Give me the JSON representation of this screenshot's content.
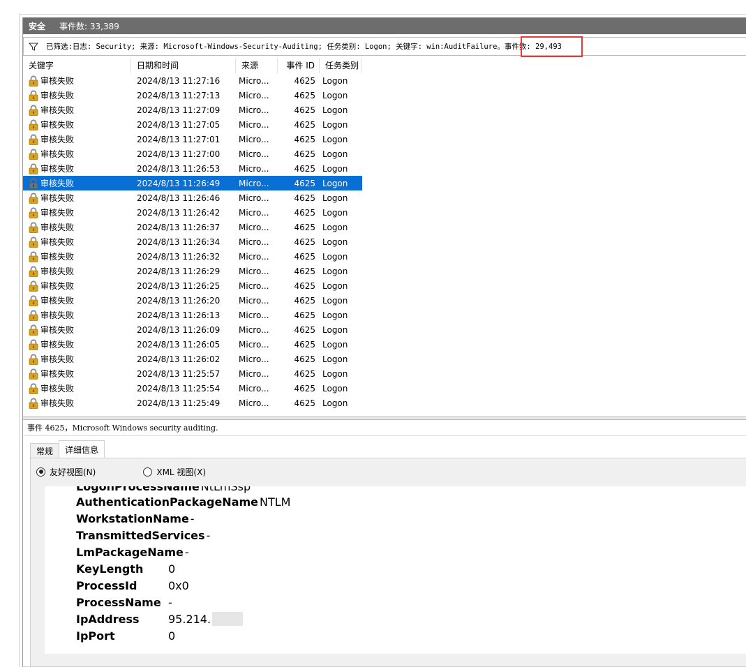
{
  "title_bar": {
    "log_name": "安全",
    "event_count": "事件数: 33,389"
  },
  "filter": {
    "text": "已筛选:日志: Security; 来源: Microsoft-Windows-Security-Auditing; 任务类别: Logon; 关键字: win:AuditFailure。事件数: 29,493",
    "icon": "funnel-icon"
  },
  "columns": [
    "关键字",
    "日期和时间",
    "来源",
    "事件 ID",
    "任务类别"
  ],
  "rows": [
    {
      "keyword": "审核失败",
      "datetime": "2024/8/13 11:27:16",
      "source": "Micro...",
      "event_id": "4625",
      "category": "Logon"
    },
    {
      "keyword": "审核失败",
      "datetime": "2024/8/13 11:27:13",
      "source": "Micro...",
      "event_id": "4625",
      "category": "Logon"
    },
    {
      "keyword": "审核失败",
      "datetime": "2024/8/13 11:27:09",
      "source": "Micro...",
      "event_id": "4625",
      "category": "Logon"
    },
    {
      "keyword": "审核失败",
      "datetime": "2024/8/13 11:27:05",
      "source": "Micro...",
      "event_id": "4625",
      "category": "Logon"
    },
    {
      "keyword": "审核失败",
      "datetime": "2024/8/13 11:27:01",
      "source": "Micro...",
      "event_id": "4625",
      "category": "Logon"
    },
    {
      "keyword": "审核失败",
      "datetime": "2024/8/13 11:27:00",
      "source": "Micro...",
      "event_id": "4625",
      "category": "Logon"
    },
    {
      "keyword": "审核失败",
      "datetime": "2024/8/13 11:26:53",
      "source": "Micro...",
      "event_id": "4625",
      "category": "Logon"
    },
    {
      "keyword": "审核失败",
      "datetime": "2024/8/13 11:26:49",
      "source": "Micro...",
      "event_id": "4625",
      "category": "Logon",
      "selected": true
    },
    {
      "keyword": "审核失败",
      "datetime": "2024/8/13 11:26:46",
      "source": "Micro...",
      "event_id": "4625",
      "category": "Logon"
    },
    {
      "keyword": "审核失败",
      "datetime": "2024/8/13 11:26:42",
      "source": "Micro...",
      "event_id": "4625",
      "category": "Logon"
    },
    {
      "keyword": "审核失败",
      "datetime": "2024/8/13 11:26:37",
      "source": "Micro...",
      "event_id": "4625",
      "category": "Logon"
    },
    {
      "keyword": "审核失败",
      "datetime": "2024/8/13 11:26:34",
      "source": "Micro...",
      "event_id": "4625",
      "category": "Logon"
    },
    {
      "keyword": "审核失败",
      "datetime": "2024/8/13 11:26:32",
      "source": "Micro...",
      "event_id": "4625",
      "category": "Logon"
    },
    {
      "keyword": "审核失败",
      "datetime": "2024/8/13 11:26:29",
      "source": "Micro...",
      "event_id": "4625",
      "category": "Logon"
    },
    {
      "keyword": "审核失败",
      "datetime": "2024/8/13 11:26:25",
      "source": "Micro...",
      "event_id": "4625",
      "category": "Logon"
    },
    {
      "keyword": "审核失败",
      "datetime": "2024/8/13 11:26:20",
      "source": "Micro...",
      "event_id": "4625",
      "category": "Logon"
    },
    {
      "keyword": "审核失败",
      "datetime": "2024/8/13 11:26:13",
      "source": "Micro...",
      "event_id": "4625",
      "category": "Logon"
    },
    {
      "keyword": "审核失败",
      "datetime": "2024/8/13 11:26:09",
      "source": "Micro...",
      "event_id": "4625",
      "category": "Logon"
    },
    {
      "keyword": "审核失败",
      "datetime": "2024/8/13 11:26:05",
      "source": "Micro...",
      "event_id": "4625",
      "category": "Logon"
    },
    {
      "keyword": "审核失败",
      "datetime": "2024/8/13 11:26:02",
      "source": "Micro...",
      "event_id": "4625",
      "category": "Logon"
    },
    {
      "keyword": "审核失败",
      "datetime": "2024/8/13 11:25:57",
      "source": "Micro...",
      "event_id": "4625",
      "category": "Logon"
    },
    {
      "keyword": "审核失败",
      "datetime": "2024/8/13 11:25:54",
      "source": "Micro...",
      "event_id": "4625",
      "category": "Logon"
    },
    {
      "keyword": "审核失败",
      "datetime": "2024/8/13 11:25:49",
      "source": "Micro...",
      "event_id": "4625",
      "category": "Logon"
    }
  ],
  "row_icon": "lock-icon",
  "detail": {
    "title": "事件 4625，Microsoft Windows security auditing.",
    "tabs": [
      "常规",
      "详细信息"
    ],
    "active_tab": "详细信息",
    "view_options": {
      "friendly": "友好视图(N)",
      "xml": "XML 视图(X)",
      "selected": "friendly"
    },
    "fields_cut": {
      "key": "LogonProcessName",
      "value": "NtLmSsp"
    },
    "fields": [
      {
        "key": "AuthenticationPackageName",
        "value": "NTLM",
        "style": "wide"
      },
      {
        "key": "WorkstationName",
        "value": "-",
        "style": "wide"
      },
      {
        "key": "TransmittedServices",
        "value": "-",
        "style": "wide"
      },
      {
        "key": "LmPackageName",
        "value": "-",
        "style": "wide"
      },
      {
        "key": "KeyLength",
        "value": "0",
        "style": "narrow"
      },
      {
        "key": "ProcessId",
        "value": "0x0",
        "style": "narrow"
      },
      {
        "key": "ProcessName",
        "value": "-",
        "style": "narrow"
      },
      {
        "key": "IpAddress",
        "value": "95.214.",
        "style": "narrow",
        "redacted": true
      },
      {
        "key": "IpPort",
        "value": "0",
        "style": "narrow"
      }
    ]
  },
  "colors": {
    "title_bar": "#6d6d6d",
    "selected_row": "#0a6fd4",
    "highlight_box": "#e03a3a",
    "lock_gold": "#d9a21b"
  }
}
